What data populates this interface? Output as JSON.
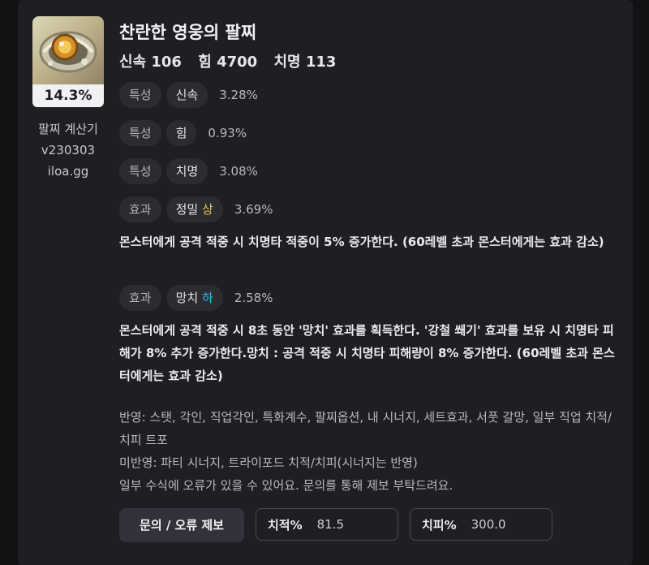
{
  "item": {
    "name": "찬란한 영웅의 팔찌",
    "percent": "14.3%",
    "stats": [
      {
        "label": "신속 106"
      },
      {
        "label": "힘 4700"
      },
      {
        "label": "치명 113"
      }
    ]
  },
  "sidebar": {
    "calc_title": "팔찌 계산기",
    "version": "v230303",
    "site": "iloa.gg"
  },
  "options": [
    {
      "type": "특성",
      "name": "신속",
      "grade": "",
      "value": "3.28%"
    },
    {
      "type": "특성",
      "name": "힘",
      "grade": "",
      "value": "0.93%"
    },
    {
      "type": "특성",
      "name": "치명",
      "grade": "",
      "value": "3.08%"
    },
    {
      "type": "효과",
      "name": "정밀",
      "grade": "상",
      "value": "3.69%",
      "desc": "몬스터에게 공격 적중 시 치명타 적중이 5% 증가한다. (60레벨 초과 몬스터에게는 효과 감소)"
    },
    {
      "type": "효과",
      "name": "망치",
      "grade": "하",
      "value": "2.58%",
      "desc": "몬스터에게 공격 적중 시 8초 동안 '망치' 효과를 획득한다. '강철 쐐기' 효과를 보유 시 치명타 피해가 8% 추가 증가한다.망치 : 공격 적중 시 치명타 피해량이 8% 증가한다. (60레벨 초과 몬스터에게는 효과 감소)"
    }
  ],
  "notes": {
    "reflected": "반영: 스탯, 각인, 직업각인, 특화계수, 팔찌옵션, 내 시너지, 세트효과, 서풋 갈망, 일부 직업 치적/치피 트포",
    "not_reflected": "미반영: 파티 시너지, 트라이포드 치적/치피(시너지는 반영)",
    "disclaimer": "일부 수식에 오류가 있을 수 있어요. 문의를 통해 제보 부탁드려요."
  },
  "footer": {
    "report_button": "문의 / 오류 제보",
    "crit_rate_label": "치적%",
    "crit_rate_value": "81.5",
    "crit_dmg_label": "치피%",
    "crit_dmg_value": "300.0"
  },
  "colors": {
    "grade_high": "#e8c244",
    "grade_low": "#3eb3ee"
  }
}
